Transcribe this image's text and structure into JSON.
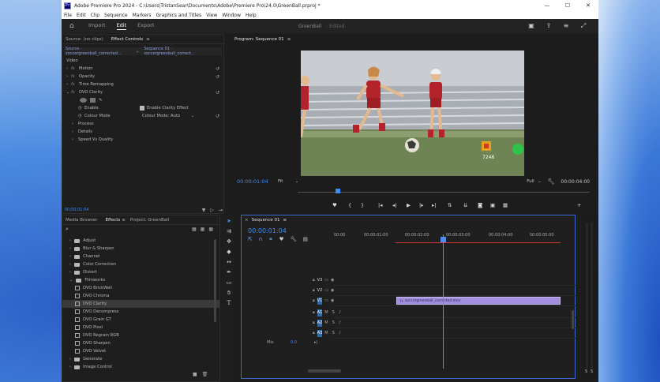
{
  "window": {
    "title": "Adobe Premiere Pro 2024 - C:\\Users\\TristanSear\\Documents\\Adobe\\Premiere Pro\\24.0\\GreenBall.prproj *",
    "app_icon": "Pr"
  },
  "menu": [
    "File",
    "Edit",
    "Clip",
    "Sequence",
    "Markers",
    "Graphics and Titles",
    "View",
    "Window",
    "Help"
  ],
  "header": {
    "tabs": [
      "Import",
      "Edit",
      "Export"
    ],
    "active_tab": "Edit",
    "project_name": "GreenBall",
    "project_state": "- Edited"
  },
  "source_panel": {
    "tabs": [
      "Source: (no clips)",
      "Effect Controls"
    ],
    "active_tab": "Effect Controls",
    "source_clip": "Source · soccergreenball_corrected...",
    "sequence": "Sequence 01 · soccergreenball_correct...",
    "section_label": "Video",
    "effects": [
      {
        "name": "Motion",
        "type": "fx"
      },
      {
        "name": "Opacity",
        "type": "fx"
      },
      {
        "name": "Time Remapping",
        "type": "fx"
      },
      {
        "name": "DVO Clarity",
        "type": "fx"
      }
    ],
    "clarity_params": {
      "enable_label": "Enable",
      "enable_checkbox_label": "Enable Clarity Effect",
      "colour_mode_label": "Colour Mode",
      "colour_mode_value": "Colour Mode: Auto",
      "subgroups": [
        "Process",
        "Details",
        "Speed Vs Quality"
      ]
    },
    "timecode": "00:00:01:04"
  },
  "program_monitor": {
    "title": "Program: Sequence 01",
    "timecode": "00:00:01:04",
    "fit": "Fit",
    "quality": "Full",
    "duration": "00:00:04:00",
    "overlay_text": "7246"
  },
  "effects_panel": {
    "tabs": [
      "Media Browser",
      "Effects",
      "Project: GreenBall"
    ],
    "active_tab": "Effects",
    "folders": [
      "Adjust",
      "Blur & Sharpen",
      "Channel",
      "Color Correction",
      "Distort",
      "Filmworks"
    ],
    "filmworks_items": [
      "DVO BrickWall",
      "DVO Chroma",
      "DVO Clarity",
      "DVO Decompress",
      "DVO Grain GT",
      "DVO Pixel",
      "DVO Regrain RGB",
      "DVO Sharpen",
      "DVO Velvet"
    ],
    "selected_item": "DVO Clarity",
    "after_folders": [
      "Generate",
      "Image Control"
    ]
  },
  "timeline": {
    "title": "Sequence 01",
    "timecode": "00:00:01:04",
    "ruler": [
      "00:00",
      "00:00:01:00",
      "00:00:02:00",
      "00:00:03:00",
      "00:00:04:00",
      "00:00:05:00"
    ],
    "video_tracks": [
      "V3",
      "V2",
      "V1"
    ],
    "audio_tracks": [
      "A1",
      "A2",
      "A3"
    ],
    "mix_label": "Mix",
    "mix_value": "0.0",
    "clip_name": "soccergreenball_corrected.mov"
  }
}
